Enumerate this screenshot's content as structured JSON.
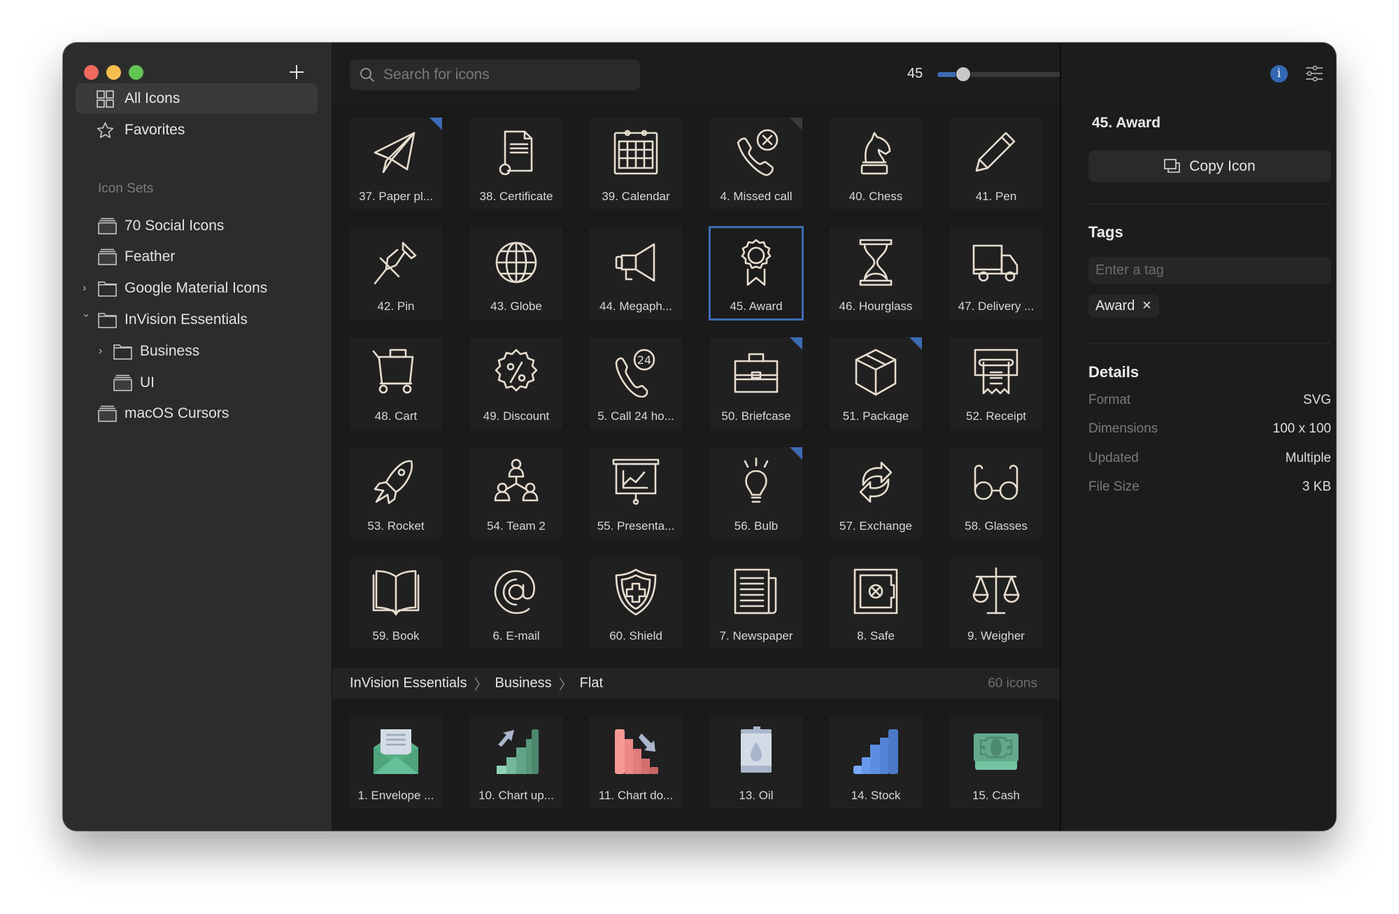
{
  "window": {
    "controls": [
      "close",
      "minimize",
      "zoom"
    ]
  },
  "sidebar": {
    "add_icon": "plus-icon",
    "nav": [
      {
        "label": "All Icons",
        "icon": "grid-icon",
        "active": true
      },
      {
        "label": "Favorites",
        "icon": "star-icon",
        "active": false
      }
    ],
    "section_label": "Icon Sets",
    "sets": [
      {
        "label": "70 Social Icons",
        "icon": "stack-icon",
        "chevron": null,
        "depth": 0
      },
      {
        "label": "Feather",
        "icon": "stack-icon",
        "chevron": null,
        "depth": 0
      },
      {
        "label": "Google Material Icons",
        "icon": "folder-icon",
        "chevron": "right",
        "depth": 0
      },
      {
        "label": "InVision Essentials",
        "icon": "folder-icon",
        "chevron": "down",
        "depth": 0
      },
      {
        "label": "Business",
        "icon": "folder-icon",
        "chevron": "right",
        "depth": 1
      },
      {
        "label": "UI",
        "icon": "stack-icon",
        "chevron": null,
        "depth": 1
      },
      {
        "label": "macOS Cursors",
        "icon": "stack-icon",
        "chevron": null,
        "depth": 0
      }
    ]
  },
  "toolbar": {
    "search_placeholder": "Search for icons",
    "search_value": "",
    "size_value": "45",
    "size_fraction": 0.155
  },
  "grid": {
    "icons": [
      {
        "label": "37. Paper pl...",
        "icon": "paper-plane-icon",
        "corner": "blue"
      },
      {
        "label": "38. Certificate",
        "icon": "certificate-icon",
        "corner": null
      },
      {
        "label": "39. Calendar",
        "icon": "calendar-icon",
        "corner": null
      },
      {
        "label": "4. Missed call",
        "icon": "missed-call-icon",
        "corner": "gray"
      },
      {
        "label": "40. Chess",
        "icon": "chess-knight-icon",
        "corner": null
      },
      {
        "label": "41. Pen",
        "icon": "pen-icon",
        "corner": null
      },
      {
        "label": "42. Pin",
        "icon": "pin-icon",
        "corner": null
      },
      {
        "label": "43. Globe",
        "icon": "globe-icon",
        "corner": null
      },
      {
        "label": "44. Megaph...",
        "icon": "megaphone-icon",
        "corner": null
      },
      {
        "label": "45. Award",
        "icon": "award-icon",
        "corner": null,
        "selected": true
      },
      {
        "label": "46. Hourglass",
        "icon": "hourglass-icon",
        "corner": null
      },
      {
        "label": "47. Delivery ...",
        "icon": "delivery-truck-icon",
        "corner": null
      },
      {
        "label": "48. Cart",
        "icon": "cart-icon",
        "corner": null
      },
      {
        "label": "49. Discount",
        "icon": "discount-icon",
        "corner": null
      },
      {
        "label": "5. Call 24 ho...",
        "icon": "call-24-icon",
        "corner": null
      },
      {
        "label": "50. Briefcase",
        "icon": "briefcase-icon",
        "corner": "blue"
      },
      {
        "label": "51. Package",
        "icon": "package-icon",
        "corner": "blue"
      },
      {
        "label": "52. Receipt",
        "icon": "receipt-icon",
        "corner": null
      },
      {
        "label": "53. Rocket",
        "icon": "rocket-icon",
        "corner": null
      },
      {
        "label": "54. Team 2",
        "icon": "team-icon",
        "corner": null
      },
      {
        "label": "55. Presenta...",
        "icon": "presentation-icon",
        "corner": null
      },
      {
        "label": "56. Bulb",
        "icon": "bulb-icon",
        "corner": "blue"
      },
      {
        "label": "57. Exchange",
        "icon": "exchange-icon",
        "corner": null
      },
      {
        "label": "58. Glasses",
        "icon": "glasses-icon",
        "corner": null
      },
      {
        "label": "59. Book",
        "icon": "book-icon",
        "corner": null
      },
      {
        "label": "6. E-mail",
        "icon": "at-sign-icon",
        "corner": null
      },
      {
        "label": "60. Shield",
        "icon": "shield-icon",
        "corner": null
      },
      {
        "label": "7. Newspaper",
        "icon": "newspaper-icon",
        "corner": null
      },
      {
        "label": "8. Safe",
        "icon": "safe-icon",
        "corner": null
      },
      {
        "label": "9. Weigher",
        "icon": "scales-icon",
        "corner": null
      }
    ]
  },
  "breadcrumb": {
    "items": [
      "InVision Essentials",
      "Business",
      "Flat"
    ],
    "count": "60 icons"
  },
  "flat": {
    "icons": [
      {
        "label": "1. Envelope ...",
        "icon": "envelope-icon"
      },
      {
        "label": "10. Chart up...",
        "icon": "chart-up-icon"
      },
      {
        "label": "11. Chart do...",
        "icon": "chart-down-icon"
      },
      {
        "label": "13. Oil",
        "icon": "oil-can-icon"
      },
      {
        "label": "14. Stock",
        "icon": "stock-chart-icon"
      },
      {
        "label": "15. Cash",
        "icon": "cash-icon"
      }
    ]
  },
  "panel": {
    "title": "45. Award",
    "copy_label": "Copy Icon",
    "tags_heading": "Tags",
    "tag_placeholder": "Enter a tag",
    "tags": [
      "Award"
    ],
    "details_heading": "Details",
    "details": [
      {
        "key": "Format",
        "value": "SVG"
      },
      {
        "key": "Dimensions",
        "value": "100 x 100"
      },
      {
        "key": "Updated",
        "value": "Multiple"
      },
      {
        "key": "File Size",
        "value": "3 KB"
      }
    ]
  },
  "colors": {
    "accent": "#3d6bb3",
    "info": "#3366b3",
    "icon_stroke": "#e7ddd0"
  }
}
